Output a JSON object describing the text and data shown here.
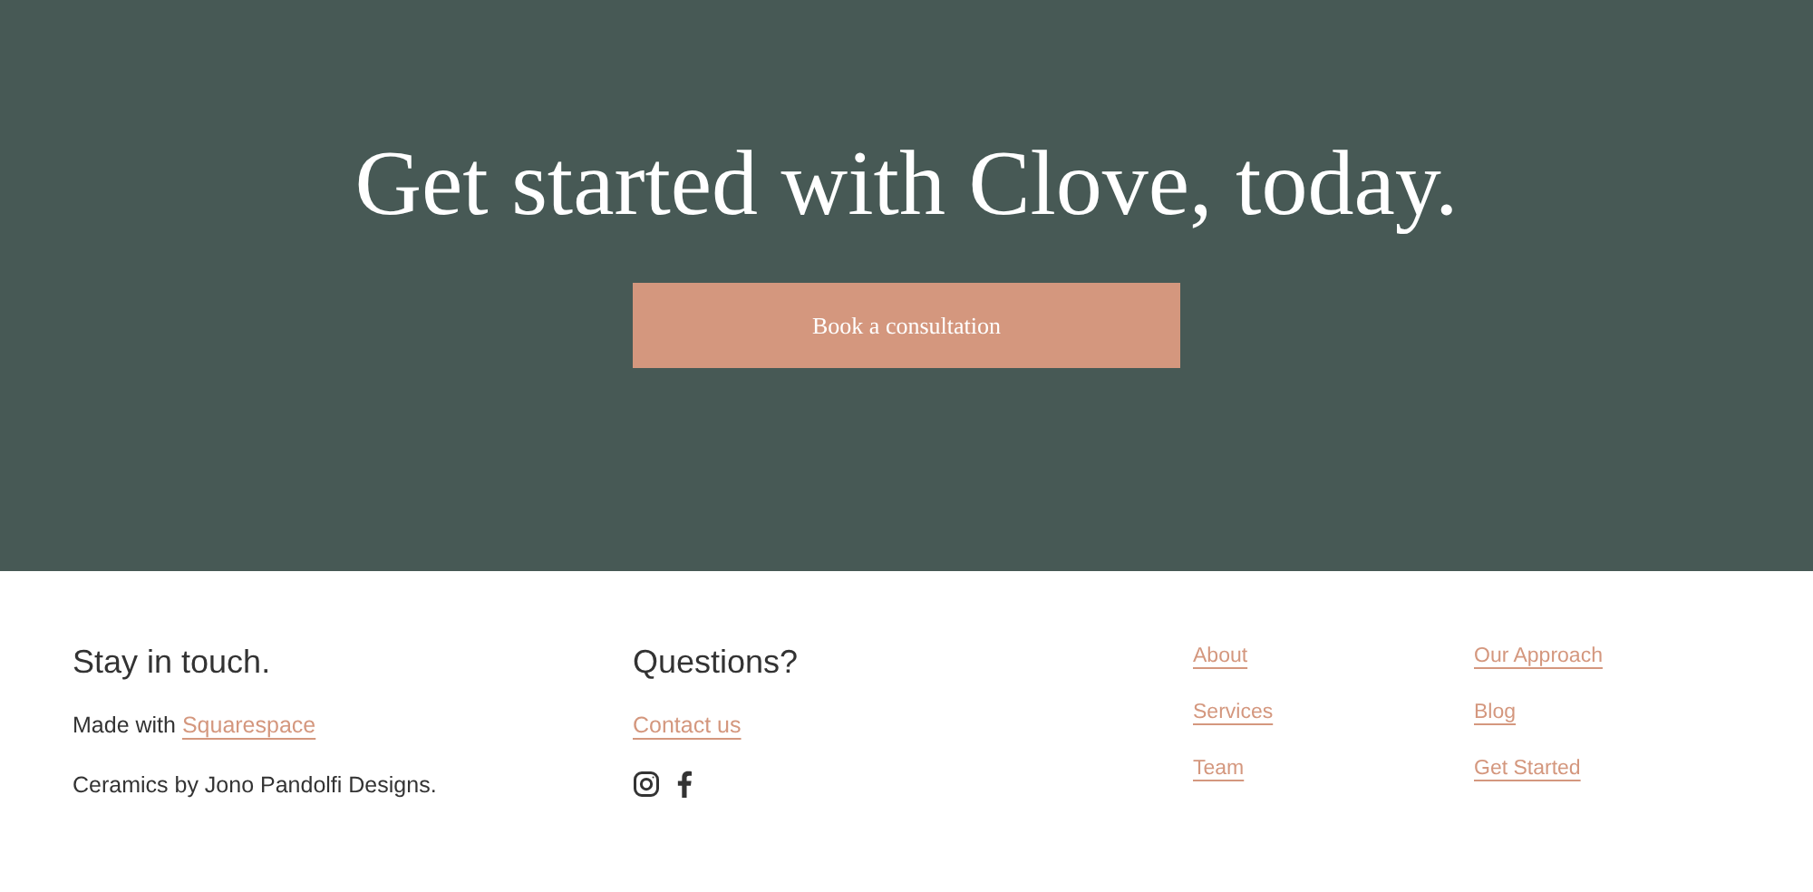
{
  "hero": {
    "title": "Get started with Clove, today.",
    "button": "Book a consultation"
  },
  "footer": {
    "contact": {
      "heading": "Stay in touch.",
      "credit_text": "Made with",
      "credit_link": "Squarespace",
      "note": "Ceramics by Jono Pandolfi Designs."
    },
    "questions": {
      "heading": "Questions?",
      "link": "Contact us",
      "social": [
        {
          "kind": "instagram"
        },
        {
          "kind": "facebook"
        }
      ]
    },
    "nav_columns": [
      [
        "About",
        "Services",
        "Team"
      ],
      [
        "Our Approach",
        "Blog",
        "Get Started"
      ]
    ]
  }
}
